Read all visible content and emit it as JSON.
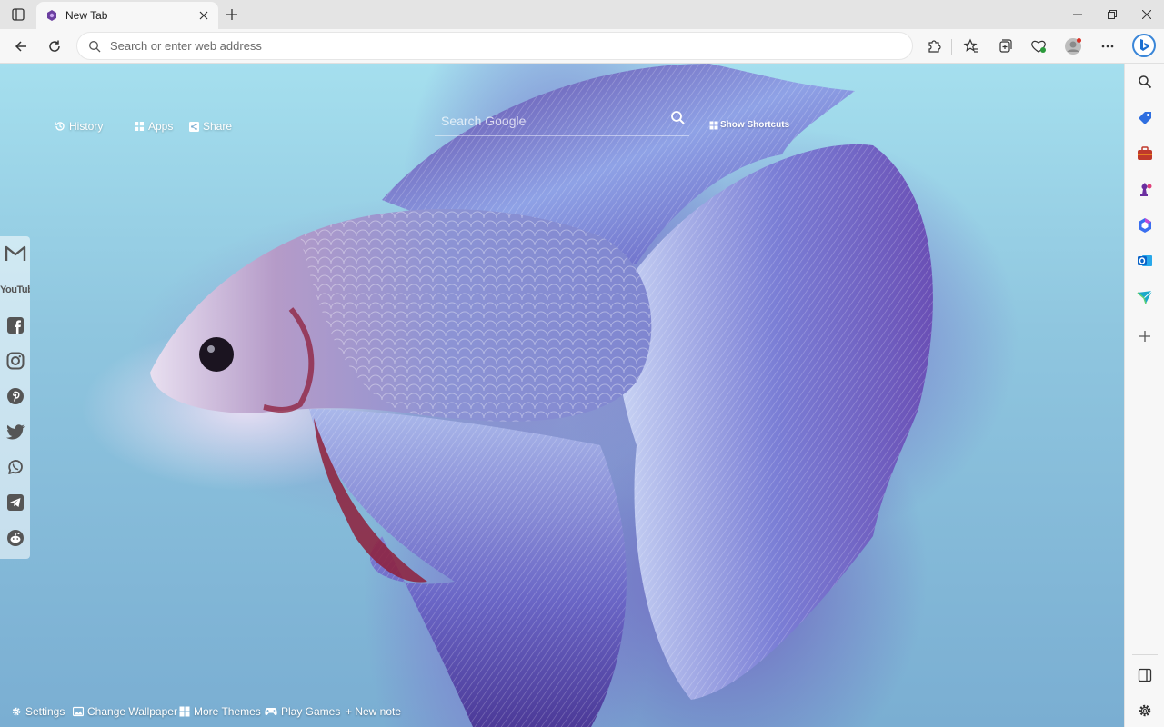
{
  "window": {
    "tab_title": "New Tab"
  },
  "address_bar": {
    "placeholder": "Search or enter web address",
    "value": ""
  },
  "newtab": {
    "links": {
      "history": "History",
      "apps": "Apps",
      "share": "Share"
    },
    "search_placeholder": "Search Google",
    "show_shortcuts": "Show Shortcuts",
    "social_icons": [
      "gmail-icon",
      "youtube-icon",
      "facebook-icon",
      "instagram-icon",
      "pinterest-icon",
      "twitter-icon",
      "whatsapp-icon",
      "telegram-icon",
      "reddit-icon"
    ],
    "youtube_text": "YouTube",
    "bottom": {
      "settings": "Settings",
      "change_wallpaper": "Change Wallpaper",
      "more_themes": "More Themes",
      "play_games": "Play Games",
      "new_note": "+ New note"
    }
  },
  "sidebar_icons": [
    "search-icon",
    "shopping-tag-icon",
    "tools-briefcase-icon",
    "games-chess-icon",
    "microsoft-365-icon",
    "outlook-icon",
    "drop-icon",
    "add-icon",
    "split-screen-icon",
    "settings-gear-icon"
  ],
  "colors": {
    "accent": "#1a73e8",
    "bg_top": "#a5dfee",
    "bg_bottom": "#7aaed2",
    "fish_purple": "#6e5ec4",
    "fish_red": "#8e1e3a"
  }
}
